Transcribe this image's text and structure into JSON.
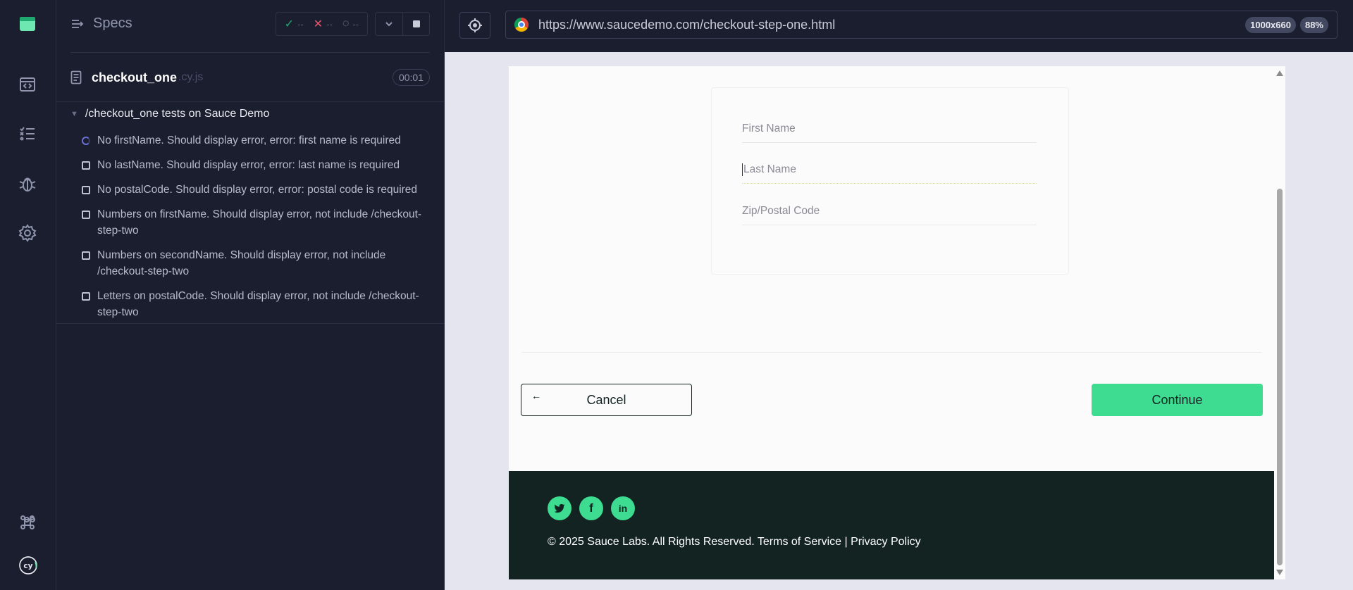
{
  "rail": {
    "icons": [
      "app-logo-icon",
      "code-window-icon",
      "runs-list-icon",
      "debug-bug-icon",
      "settings-gear-icon",
      "keyboard-shortcut-icon",
      "cypress-logo-icon"
    ],
    "logo_text": "cy"
  },
  "specs": {
    "title": "Specs",
    "stats": {
      "passed": "--",
      "failed": "--",
      "pending": "--"
    },
    "file": {
      "name": "checkout_one",
      "ext": ".cy.js",
      "duration": "00:01"
    },
    "suite": "/checkout_one tests on Sauce Demo",
    "tests": [
      {
        "status": "running",
        "label": "No firstName. Should display error, error: first name is required"
      },
      {
        "status": "queued",
        "label": "No lastName. Should display error, error: last name is required"
      },
      {
        "status": "queued",
        "label": "No postalCode. Should display error, error: postal code is required"
      },
      {
        "status": "queued",
        "label": "Numbers on firstName. Should display error, not include /checkout-step-two"
      },
      {
        "status": "queued",
        "label": "Numbers on secondName. Should display error, not include /checkout-step-two"
      },
      {
        "status": "queued",
        "label": "Letters on postalCode. Should display error, not include /checkout-step-two"
      }
    ]
  },
  "browser": {
    "url": "https://www.saucedemo.com/checkout-step-one.html",
    "viewport_badge": "1000x660",
    "zoom_badge": "88%"
  },
  "app": {
    "fields": {
      "first_name_placeholder": "First Name",
      "last_name_placeholder": "Last Name",
      "postal_code_placeholder": "Zip/Postal Code"
    },
    "cancel_arrow": "←",
    "cancel_label": "Cancel",
    "continue_label": "Continue",
    "footer": {
      "social": [
        "twitter-icon",
        "facebook-icon",
        "linkedin-icon"
      ],
      "twitter_glyph": "🐦",
      "facebook_glyph": "f",
      "linkedin_glyph": "in",
      "copyright": "© 2025 Sauce Labs. All Rights Reserved. Terms of Service | Privacy Policy"
    }
  },
  "colors": {
    "accent_green": "#3ddc91",
    "sauce_dark": "#132322",
    "runner_bg": "#1b1e2e",
    "pass": "#1fa971",
    "fail": "#e45770"
  }
}
